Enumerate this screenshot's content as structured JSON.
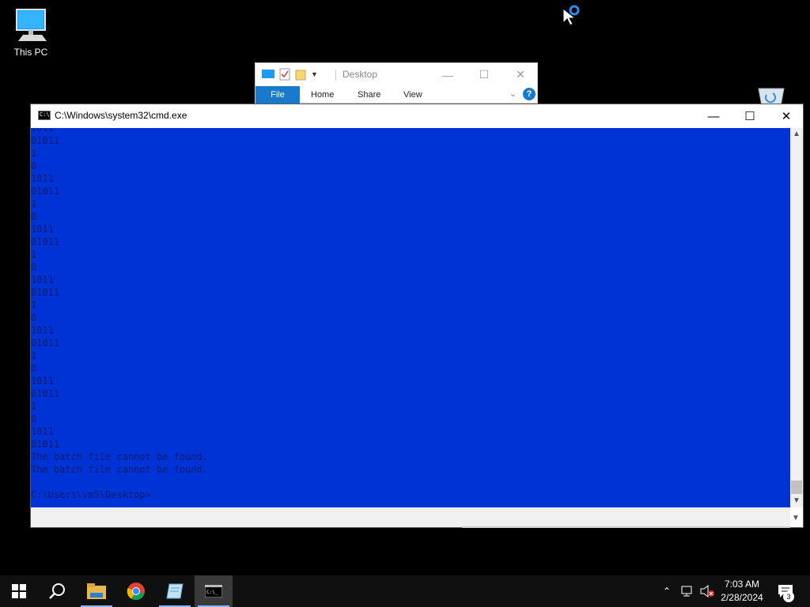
{
  "desktop": {
    "icons": [
      {
        "label": "This PC",
        "icon": "computer-icon"
      }
    ]
  },
  "explorer": {
    "title": "Desktop",
    "tabs": [
      "File",
      "Home",
      "Share",
      "View"
    ],
    "help": "?"
  },
  "cmd": {
    "title": "C:\\Windows\\system32\\cmd.exe",
    "console_bg": "#0033d6",
    "console_fg": "#0b1c6b",
    "lines": [
      "1011",
      "01011",
      "1",
      "0",
      "1011",
      "01011",
      "1",
      "0",
      "1011",
      "01011",
      "1",
      "0",
      "1011",
      "01011",
      "1",
      "0",
      "1011",
      "01011",
      "1",
      "0",
      "1011",
      "01011",
      "1",
      "0",
      "1011",
      "01011",
      "The batch file cannot be found.",
      "The batch file cannot be found.",
      "",
      "C:\\Users\\vm5\\Desktop>"
    ]
  },
  "taskbar": {
    "items": [
      {
        "name": "start",
        "icon": "windows-logo-icon"
      },
      {
        "name": "search",
        "icon": "search-icon"
      },
      {
        "name": "file-explorer",
        "icon": "folder-icon"
      },
      {
        "name": "chrome",
        "icon": "chrome-icon"
      },
      {
        "name": "notepad",
        "icon": "notepad-icon"
      },
      {
        "name": "cmd",
        "icon": "terminal-icon"
      }
    ],
    "time": "7:03 AM",
    "date": "2/28/2024",
    "notifications_count": "3"
  }
}
